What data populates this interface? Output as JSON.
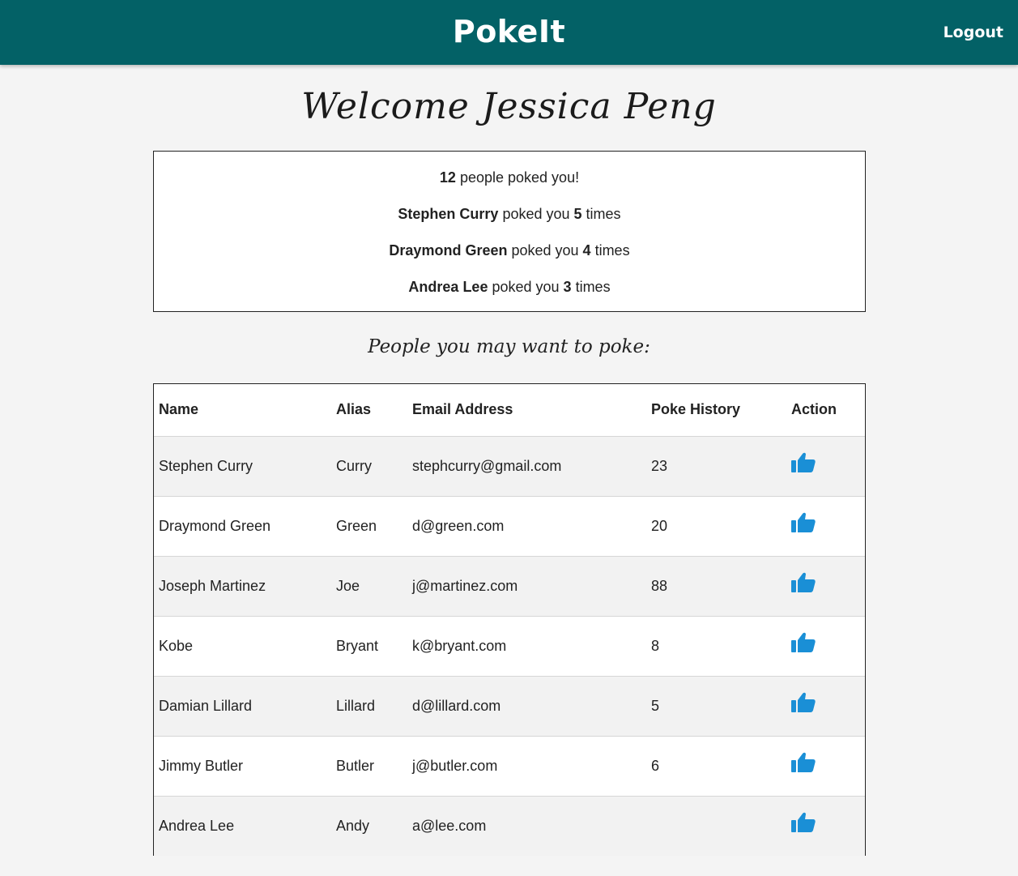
{
  "header": {
    "brand": "PokeIt",
    "logout_label": "Logout"
  },
  "welcome": "Welcome Jessica Peng",
  "summary": {
    "count": "12",
    "count_suffix": " people poked you!",
    "pokers": [
      {
        "name": "Stephen Curry",
        "mid": " poked you ",
        "times": "5",
        "suffix": " times"
      },
      {
        "name": "Draymond Green",
        "mid": " poked you ",
        "times": "4",
        "suffix": " times"
      },
      {
        "name": "Andrea Lee",
        "mid": " poked you ",
        "times": "3",
        "suffix": " times"
      }
    ]
  },
  "subtitle": "People you may want to poke:",
  "table": {
    "headers": [
      "Name",
      "Alias",
      "Email Address",
      "Poke History",
      "Action"
    ],
    "rows": [
      {
        "name": "Stephen Curry",
        "alias": "Curry",
        "email": "stephcurry@gmail.com",
        "history": "23"
      },
      {
        "name": "Draymond Green",
        "alias": "Green",
        "email": "d@green.com",
        "history": "20"
      },
      {
        "name": "Joseph Martinez",
        "alias": "Joe",
        "email": "j@martinez.com",
        "history": "88"
      },
      {
        "name": "Kobe",
        "alias": "Bryant",
        "email": "k@bryant.com",
        "history": "8"
      },
      {
        "name": "Damian Lillard",
        "alias": "Lillard",
        "email": "d@lillard.com",
        "history": "5"
      },
      {
        "name": "Jimmy Butler",
        "alias": "Butler",
        "email": "j@butler.com",
        "history": "6"
      },
      {
        "name": "Andrea Lee",
        "alias": "Andy",
        "email": "a@lee.com",
        "history": ""
      }
    ],
    "action_icon": "thumbs-up-icon"
  },
  "colors": {
    "header_bg": "#036166",
    "thumb": "#1a8fd6"
  }
}
